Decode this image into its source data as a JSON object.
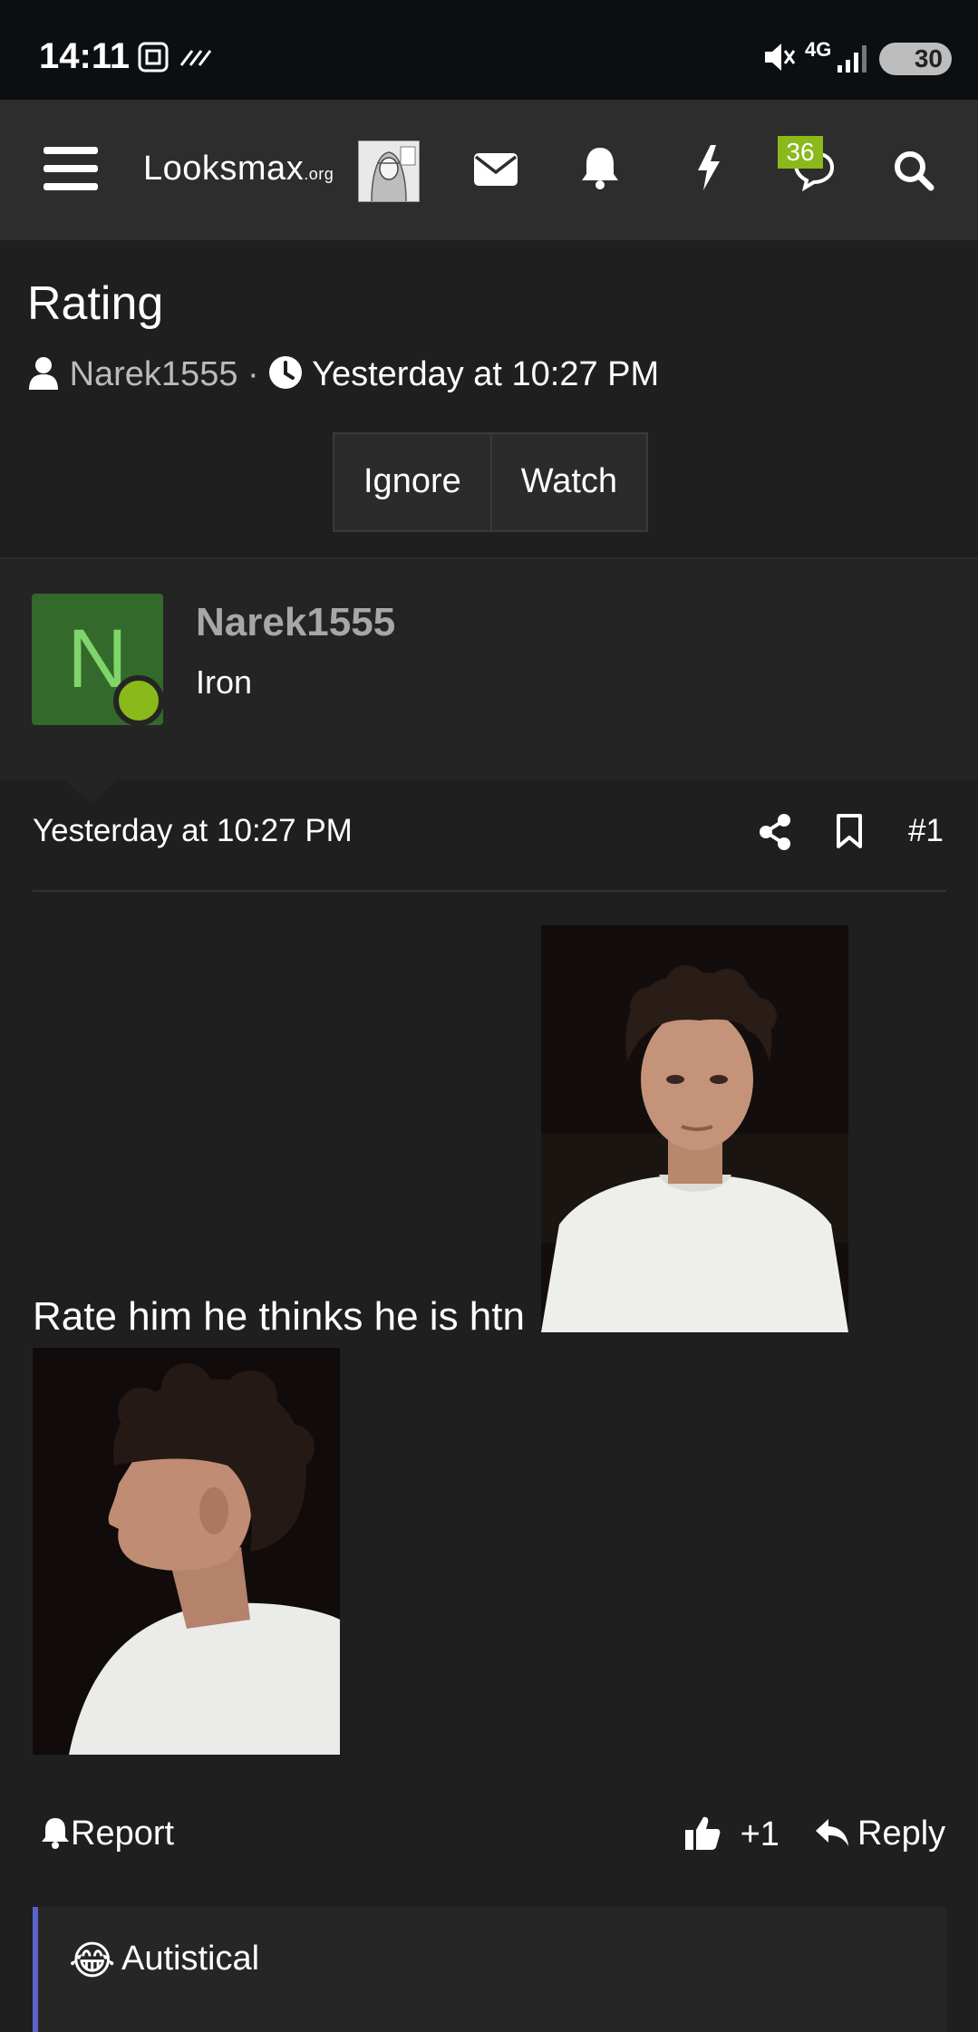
{
  "status_bar": {
    "time": "14:11",
    "network": "4G",
    "battery": "30"
  },
  "nav": {
    "logo": "Looksmax",
    "logo_suffix": ".org",
    "badge_count": "36",
    "icons": [
      "menu-icon",
      "mail-icon",
      "bell-icon",
      "bolt-icon",
      "chat-icon",
      "search-icon"
    ]
  },
  "thread": {
    "title": "Rating",
    "author": "Narek1555",
    "separator": "·",
    "date": "Yesterday at 10:27 PM",
    "buttons": {
      "ignore": "Ignore",
      "watch": "Watch"
    }
  },
  "user": {
    "avatar_letter": "N",
    "name": "Narek1555",
    "role": "Iron"
  },
  "post": {
    "date": "Yesterday at 10:27 PM",
    "number": "#1",
    "text": "Rate him he thinks he is htn"
  },
  "actions": {
    "report": "Report",
    "likes": "+1",
    "reply": "Reply"
  },
  "reaction": {
    "emoji": "😂",
    "label": "Autistical"
  },
  "colors": {
    "background": "#1f1f1f",
    "navbar": "#2d2d2d",
    "accent_green": "#8ab91a",
    "avatar_bg": "#33692a",
    "reaction_border": "#5a63c8"
  }
}
